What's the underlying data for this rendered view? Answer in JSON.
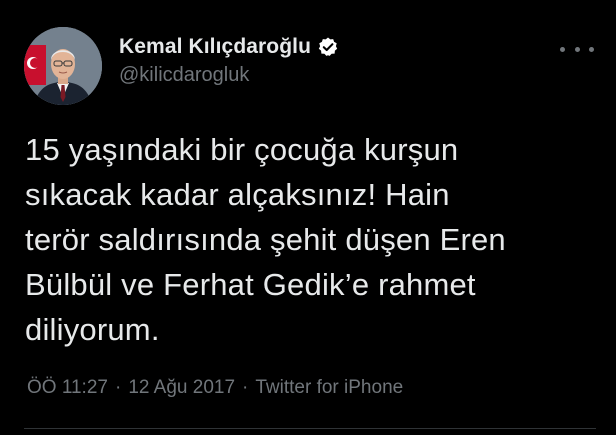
{
  "author": {
    "display_name": "Kemal Kılıçdaroğlu",
    "handle": "@kilicdarogluk",
    "verified": true,
    "avatar_icon": "profile-photo"
  },
  "menu": {
    "icon": "more-horizontal-icon"
  },
  "tweet": {
    "lines": [
      "15 yaşındaki bir çocuğa kurşun",
      "sıkacak kadar alçaksınız! Hain",
      "terör saldırısında şehit düşen Eren",
      "Bülbül ve Ferhat Gedik’e rahmet",
      "diliyorum."
    ]
  },
  "meta": {
    "time": "ÖÖ 11:27",
    "date": "12 Ağu 2017",
    "source": "Twitter for iPhone",
    "separator": "·"
  },
  "colors": {
    "background": "#000000",
    "text_primary": "#e7e9ea",
    "text_secondary": "#71767b",
    "verified_badge": "#ffffff",
    "divider": "#2f3336"
  }
}
